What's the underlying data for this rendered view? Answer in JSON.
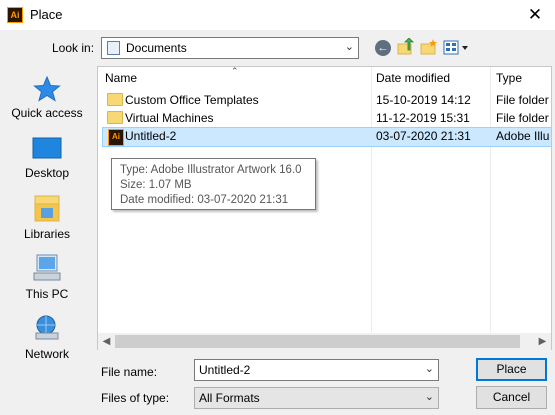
{
  "window": {
    "title": "Place",
    "app_icon_text": "Ai",
    "close_glyph": "✕"
  },
  "toolbar": {
    "look_in_label": "Look in:",
    "look_in_value": "Documents",
    "icons": [
      "back-icon",
      "up-folder-icon",
      "new-folder-icon",
      "views-menu-icon"
    ]
  },
  "places": [
    {
      "label": "Quick access",
      "icon": "quick-access-star-icon"
    },
    {
      "label": "Desktop",
      "icon": "desktop-icon"
    },
    {
      "label": "Libraries",
      "icon": "libraries-icon"
    },
    {
      "label": "This PC",
      "icon": "this-pc-icon"
    },
    {
      "label": "Network",
      "icon": "network-icon"
    }
  ],
  "file_list": {
    "columns": [
      "Name",
      "Date modified",
      "Type"
    ],
    "rows": [
      {
        "name": "Custom Office Templates",
        "date": "15-10-2019 14:12",
        "type": "File folder",
        "icon": "folder-icon",
        "selected": false
      },
      {
        "name": "Virtual Machines",
        "date": "11-12-2019 15:31",
        "type": "File folder",
        "icon": "folder-icon",
        "selected": false
      },
      {
        "name": "Untitled-2",
        "date": "03-07-2020 21:31",
        "type": "Adobe Illu",
        "icon": "illustrator-file-icon",
        "selected": true
      }
    ]
  },
  "tooltip": {
    "type": "Type: Adobe Illustrator Artwork 16.0",
    "size": "Size: 1.07 MB",
    "date": "Date modified: 03-07-2020 21:31"
  },
  "bottom": {
    "file_name_label": "File name:",
    "file_name_value": "Untitled-2",
    "files_of_type_label": "Files of type:",
    "files_of_type_value": "All Formats",
    "place_button": "Place",
    "cancel_button": "Cancel"
  },
  "colors": {
    "selection": "#cce8ff",
    "selection_border": "#99d1ff",
    "default_button_border": "#0078d7"
  }
}
